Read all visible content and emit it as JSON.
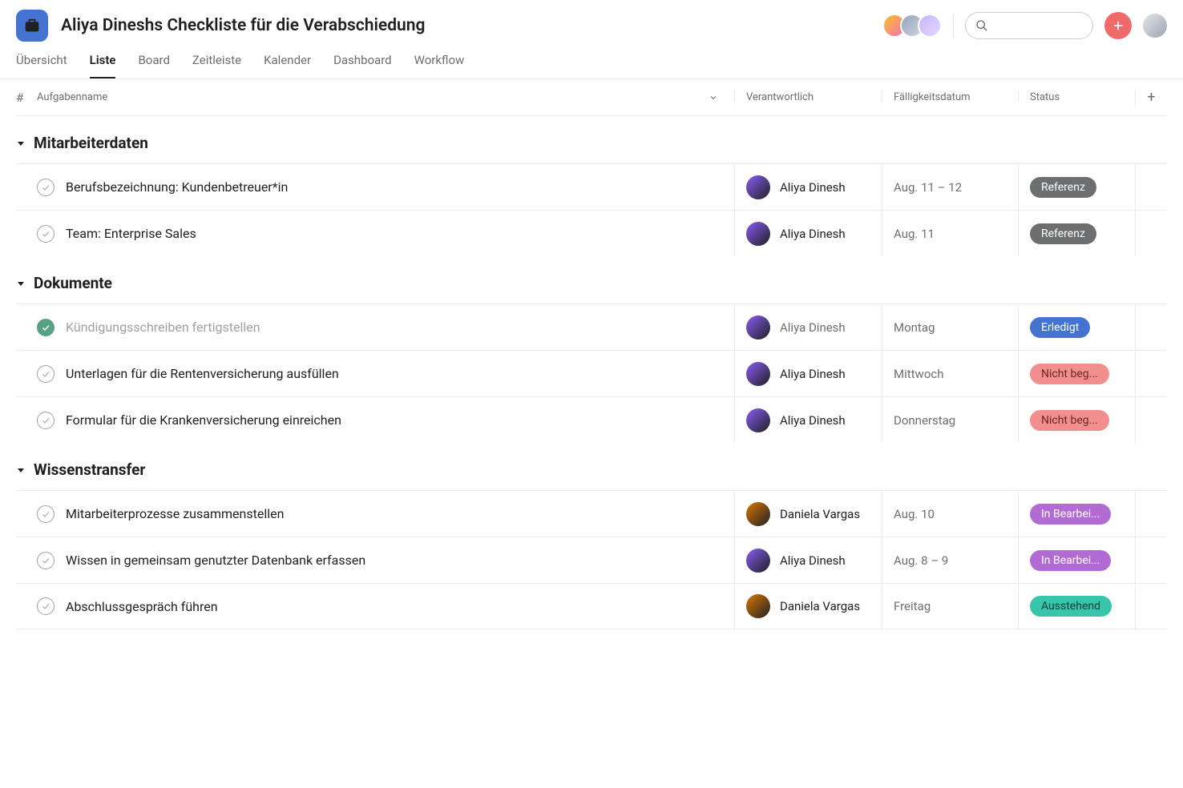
{
  "project": {
    "title": "Aliya Dineshs Checkliste für die Verabschiedung",
    "icon_bg": "#4573d2"
  },
  "header_avatars": [
    "#f9a8d4",
    "#cbd5e1",
    "#e9d5ff"
  ],
  "user_avatar": "#d1d5db",
  "tabs": [
    {
      "label": "Übersicht",
      "active": false
    },
    {
      "label": "Liste",
      "active": true
    },
    {
      "label": "Board",
      "active": false
    },
    {
      "label": "Zeitleiste",
      "active": false
    },
    {
      "label": "Kalender",
      "active": false
    },
    {
      "label": "Dashboard",
      "active": false
    },
    {
      "label": "Workflow",
      "active": false
    }
  ],
  "columns": {
    "num": "#",
    "name": "Aufgabenname",
    "assignee": "Verantwortlich",
    "due": "Fälligkeitsdatum",
    "status": "Status"
  },
  "status_styles": {
    "Referenz": {
      "bg": "#6d6e6f",
      "fg": "#ffffff"
    },
    "Erledigt": {
      "bg": "#4573d2",
      "fg": "#ffffff"
    },
    "Nicht beg...": {
      "bg": "#f38e8e",
      "fg": "#6b2626"
    },
    "In Bearbei...": {
      "bg": "#b36bd4",
      "fg": "#ffffff"
    },
    "Ausstehend": {
      "bg": "#37c5ab",
      "fg": "#0e4038"
    }
  },
  "sections": [
    {
      "title": "Mitarbeiterdaten",
      "tasks": [
        {
          "done": false,
          "name": "Berufsbezeichnung: Kundenbetreuer*in",
          "assignee": "Aliya Dinesh",
          "avatar": "#8b5cf6",
          "due": "Aug. 11 – 12",
          "status": "Referenz"
        },
        {
          "done": false,
          "name": "Team: Enterprise Sales",
          "assignee": "Aliya Dinesh",
          "avatar": "#8b5cf6",
          "due": "Aug. 11",
          "status": "Referenz"
        }
      ]
    },
    {
      "title": "Dokumente",
      "tasks": [
        {
          "done": true,
          "name": "Kündigungsschreiben fertigstellen",
          "assignee": "Aliya Dinesh",
          "avatar": "#8b5cf6",
          "due": "Montag",
          "status": "Erledigt",
          "muted": true
        },
        {
          "done": false,
          "name": "Unterlagen für die Rentenversicherung ausfüllen",
          "assignee": "Aliya Dinesh",
          "avatar": "#8b5cf6",
          "due": "Mittwoch",
          "status": "Nicht beg..."
        },
        {
          "done": false,
          "name": "Formular für die Krankenversicherung einreichen",
          "assignee": "Aliya Dinesh",
          "avatar": "#8b5cf6",
          "due": "Donnerstag",
          "status": "Nicht beg..."
        }
      ]
    },
    {
      "title": "Wissenstransfer",
      "tasks": [
        {
          "done": false,
          "name": "Mitarbeiterprozesse zusammenstellen",
          "assignee": "Daniela Vargas",
          "avatar": "#d97706",
          "due": "Aug. 10",
          "status": "In Bearbei..."
        },
        {
          "done": false,
          "name": "Wissen in gemeinsam genutzter Datenbank erfassen",
          "assignee": "Aliya Dinesh",
          "avatar": "#8b5cf6",
          "due": "Aug. 8 – 9",
          "status": "In Bearbei..."
        },
        {
          "done": false,
          "name": "Abschlussgespräch führen",
          "assignee": "Daniela Vargas",
          "avatar": "#d97706",
          "due": "Freitag",
          "status": "Ausstehend"
        }
      ]
    }
  ]
}
